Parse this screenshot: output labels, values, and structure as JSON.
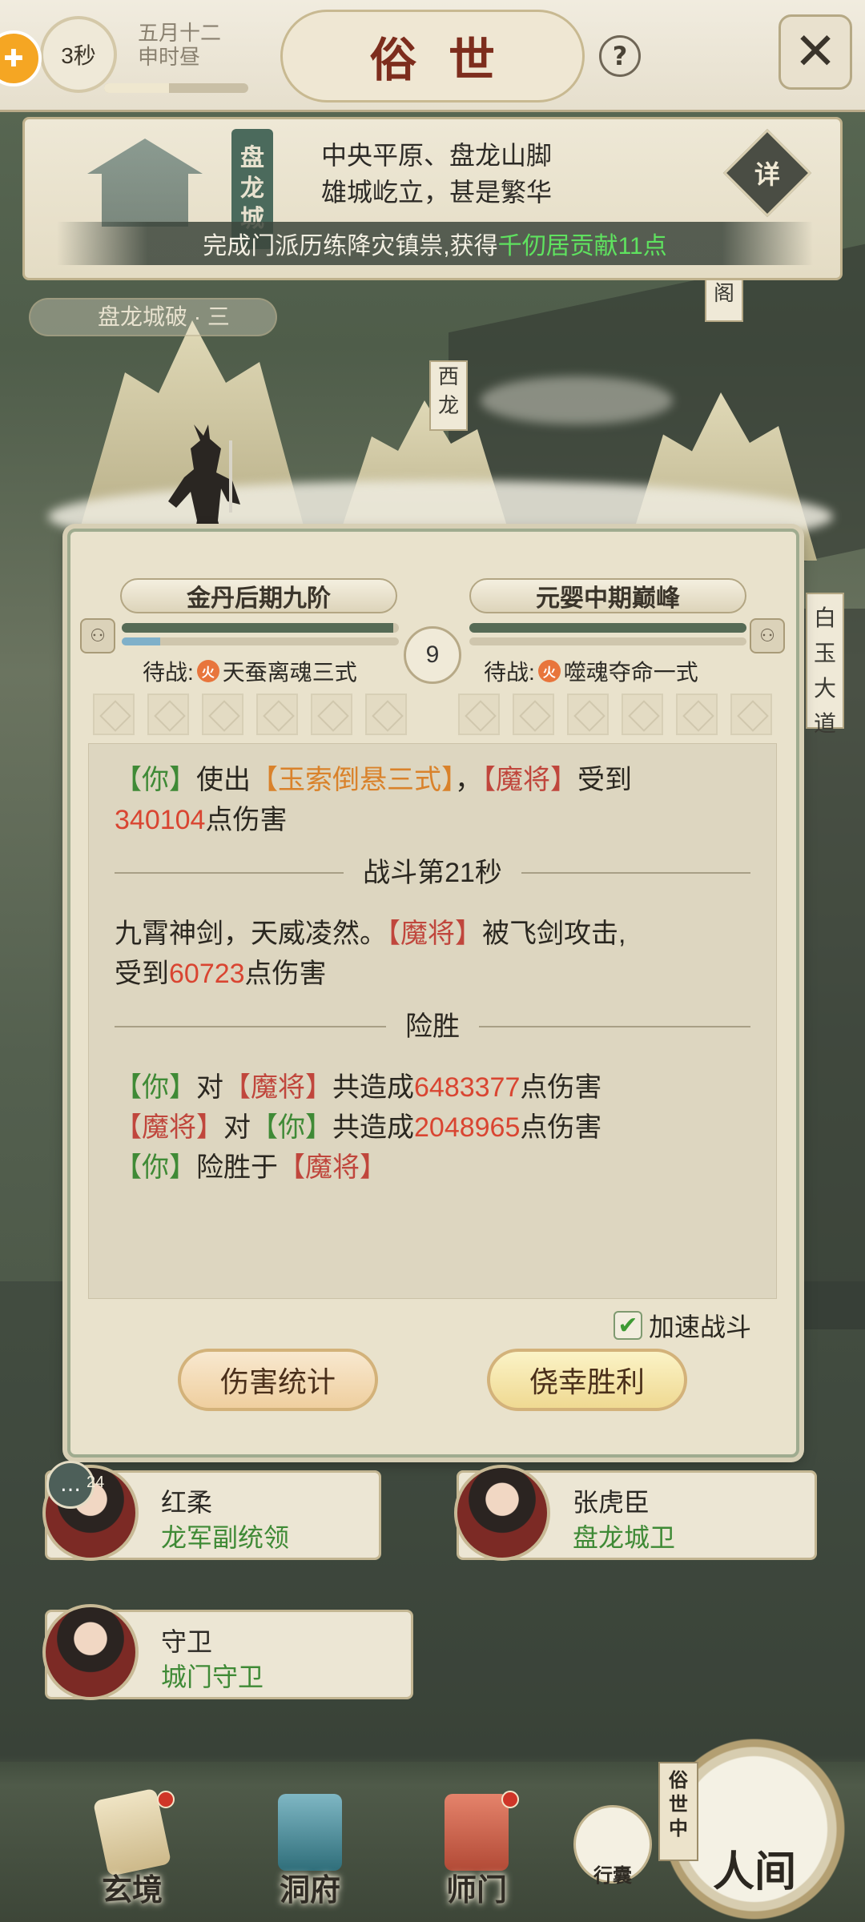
{
  "top_bar": {
    "timer": "3秒",
    "date_line1": "五月十二",
    "date_line2": "申时昼",
    "day_progress": 0.45,
    "title": "俗世",
    "help_icon": "question-icon",
    "close_icon": "crossed-swords-icon"
  },
  "location": {
    "plaque": "盘龙城",
    "description_line1": "中央平原、盘龙山脚",
    "description_line2": "雄城屹立，甚是繁华",
    "detail_button": "详",
    "banner_prefix": "完成门派历练降灾镇祟,获得",
    "banner_highlight": "千仞居贡献11点"
  },
  "map_signs": {
    "region": "盘龙城破 · 三",
    "west": "西龙",
    "right_top": "阁",
    "road": "白玉大道"
  },
  "battle": {
    "player": {
      "realm": "金丹后期九阶",
      "hp": 0.98,
      "mp": 0.14,
      "waiting_label": "待战:",
      "waiting_skill": "天蚕离魂三式",
      "element": "火"
    },
    "enemy": {
      "realm": "元婴中期巅峰",
      "hp": 1.0,
      "mp": 0.0,
      "waiting_label": "待战:",
      "waiting_skill": "噬魂夺命一式",
      "element": "火"
    },
    "round": "9",
    "log": {
      "line1_you": "【你】",
      "line1_use": "使出",
      "line1_skill": "【玉索倒悬三式】",
      "line1_comma": "，",
      "line1_target": "【魔将】",
      "line1_recv": "受到",
      "line1_damage": "340104",
      "line1_unit": "点伤害",
      "divider1": "战斗第21秒",
      "line2_text": "九霄神剑，天威凌然。",
      "line2_target": "【魔将】",
      "line2_hit": "被飞剑攻击,",
      "line2_recv": "受到",
      "line2_damage": "60723",
      "line2_unit": "点伤害",
      "divider2": "险胜",
      "sum1_a": "【你】",
      "sum1_to": "对",
      "sum1_b": "【魔将】",
      "sum1_total": "共造成",
      "sum1_value": "6483377",
      "sum1_unit": "点伤害",
      "sum2_a": "【魔将】",
      "sum2_to": "对",
      "sum2_b": "【你】",
      "sum2_total": "共造成",
      "sum2_value": "2048965",
      "sum2_unit": "点伤害",
      "sum3_a": "【你】",
      "sum3_win": "险胜于",
      "sum3_b": "【魔将】"
    },
    "speed_label": "加速战斗",
    "speed_checked": true,
    "btn_damage": "伤害统计",
    "btn_victory": "侥幸胜利"
  },
  "npcs": [
    {
      "name": "红柔",
      "role": "龙军副统领"
    },
    {
      "name": "张虎臣",
      "role": "盘龙城卫"
    },
    {
      "name": "守卫",
      "role": "城门守卫"
    }
  ],
  "chat_count": "24",
  "bottom_nav": {
    "items": [
      {
        "label": "玄境"
      },
      {
        "label": "洞府"
      },
      {
        "label": "师门"
      }
    ],
    "bag": "行囊",
    "world_tag": "俗世中",
    "world": "人间"
  },
  "colors": {
    "accent_green": "#3f8a36",
    "accent_red": "#c0463c",
    "skill_orange": "#d9822b",
    "damage_red": "#d94531",
    "banner_green": "#5fe25f"
  }
}
